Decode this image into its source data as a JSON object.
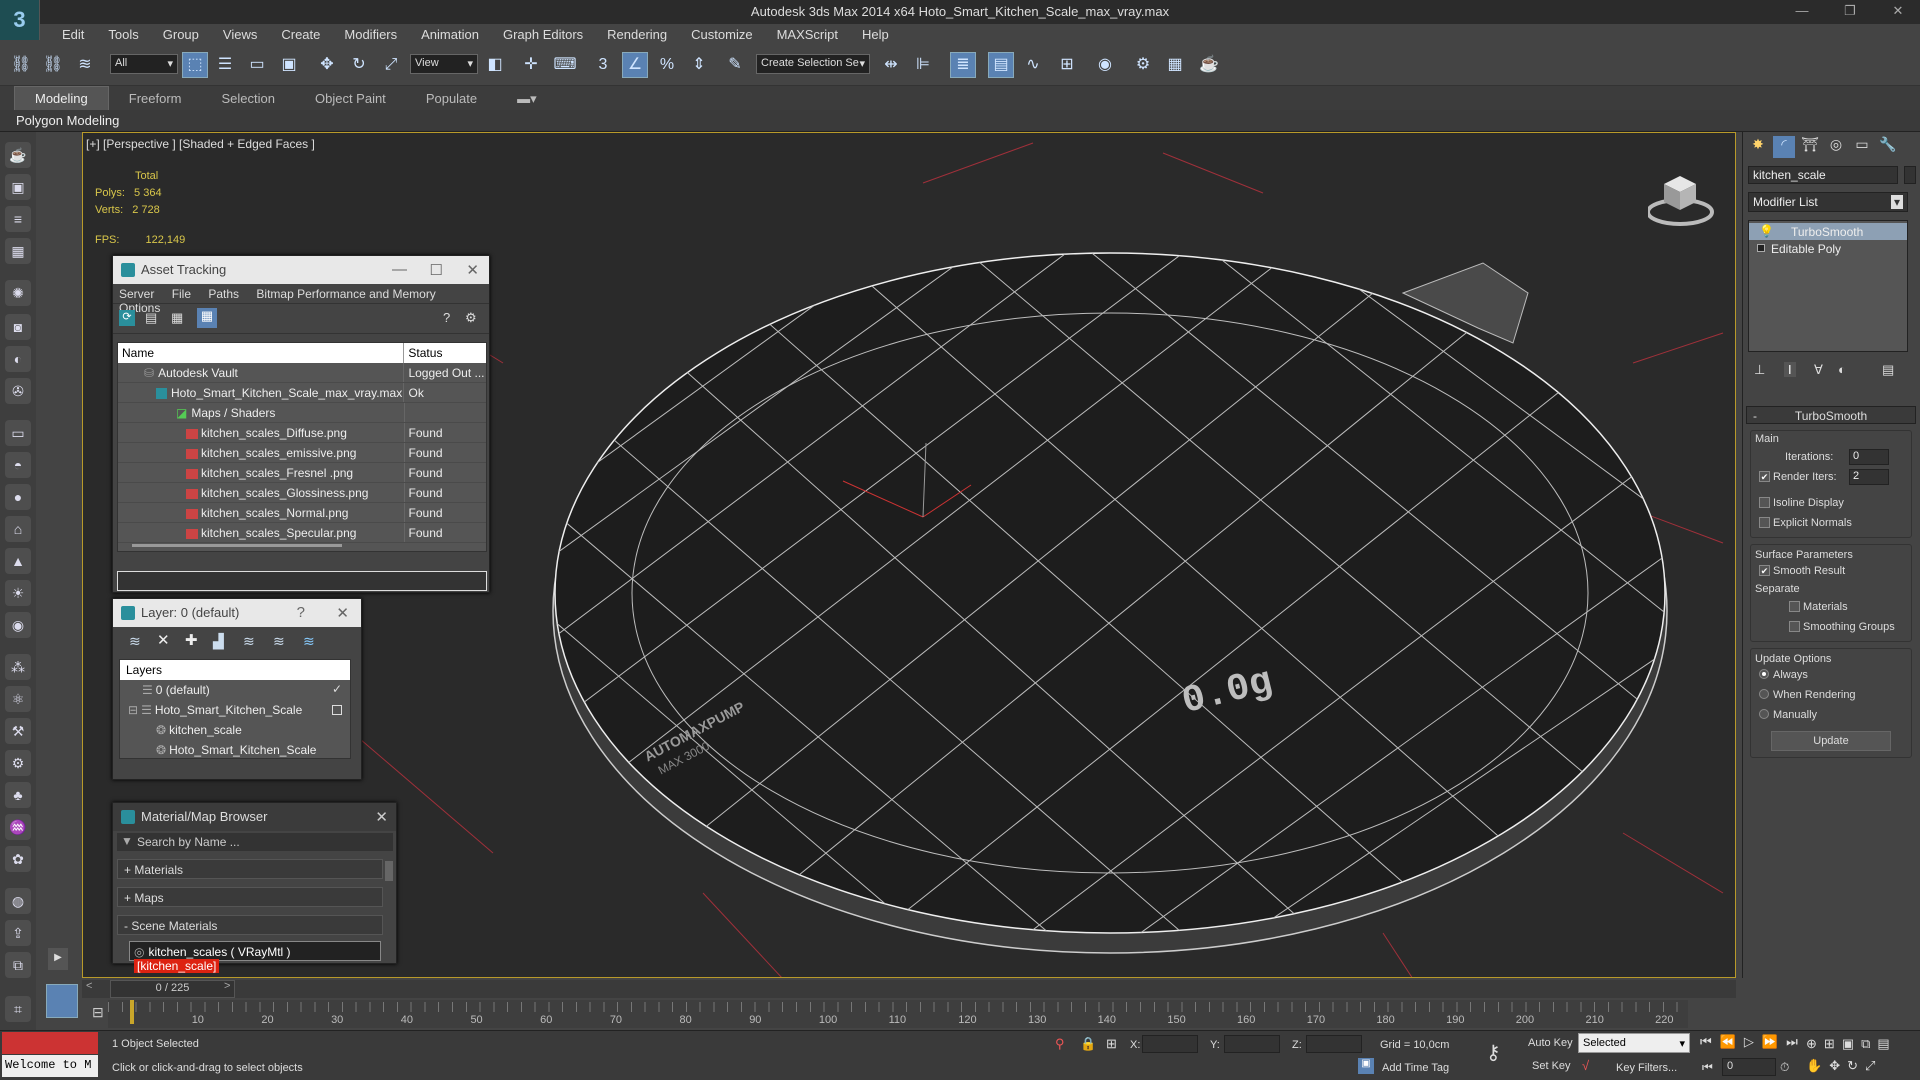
{
  "window": {
    "app": "Autodesk 3ds Max  2014 x64",
    "file": "Hoto_Smart_Kitchen_Scale_max_vray.max",
    "logo": "3"
  },
  "menu": [
    "Edit",
    "Tools",
    "Group",
    "Views",
    "Create",
    "Modifiers",
    "Animation",
    "Graph Editors",
    "Rendering",
    "Customize",
    "MAXScript",
    "Help"
  ],
  "toolbar": {
    "selection_filter": "All",
    "ref_coord": "View",
    "named_selection": "Create Selection Se"
  },
  "ribbon": {
    "tabs": [
      "Modeling",
      "Freeform",
      "Selection",
      "Object Paint",
      "Populate"
    ],
    "active_tab": "Modeling",
    "subpanel": "Polygon Modeling"
  },
  "viewport": {
    "label": "[+] [Perspective ] [Shaded + Edged Faces ]",
    "stats_header": "Total",
    "polys_label": "Polys:",
    "polys_value": "5 364",
    "verts_label": "Verts:",
    "verts_value": "2 728",
    "fps_label": "FPS:",
    "fps_value": "122,149",
    "display_digits": "0.0g",
    "model_text_1": "AUTOMAXPUMP",
    "model_text_2": "MAX 3000"
  },
  "asset_tracking": {
    "title": "Asset Tracking",
    "menu": [
      "Server",
      "File",
      "Paths",
      "Bitmap Performance and Memory",
      "Options"
    ],
    "columns": [
      "Name",
      "Status"
    ],
    "rows": [
      {
        "name": "Autodesk Vault",
        "status": "Logged Out ..."
      },
      {
        "name": "Hoto_Smart_Kitchen_Scale_max_vray.max",
        "status": "Ok"
      },
      {
        "name": "Maps / Shaders",
        "status": ""
      },
      {
        "name": "kitchen_scales_Diffuse.png",
        "status": "Found"
      },
      {
        "name": "kitchen_scales_emissive.png",
        "status": "Found"
      },
      {
        "name": "kitchen_scales_Fresnel .png",
        "status": "Found"
      },
      {
        "name": "kitchen_scales_Glossiness.png",
        "status": "Found"
      },
      {
        "name": "kitchen_scales_Normal.png",
        "status": "Found"
      },
      {
        "name": "kitchen_scales_Specular.png",
        "status": "Found"
      }
    ]
  },
  "layer": {
    "title": "Layer: 0 (default)",
    "help": "?",
    "header": "Layers",
    "items": [
      "0 (default)",
      "Hoto_Smart_Kitchen_Scale",
      "kitchen_scale",
      "Hoto_Smart_Kitchen_Scale"
    ]
  },
  "material_browser": {
    "title": "Material/Map Browser",
    "search_placeholder": "Search by Name ...",
    "sections": [
      "+ Materials",
      "+ Maps",
      "- Scene Materials"
    ],
    "item_name": "kitchen_scales  ( VRayMtl ) ",
    "item_tag": "[kitchen_scale]"
  },
  "command_panel": {
    "object_name": "kitchen_scale",
    "modifier_list": "Modifier List",
    "stack": [
      "TurboSmooth",
      "Editable Poly"
    ],
    "rollout_title": "TurboSmooth",
    "main_group": "Main",
    "iterations_label": "Iterations:",
    "iterations_value": "0",
    "render_iters_label": "Render Iters:",
    "render_iters_value": "2",
    "isoline": "Isoline Display",
    "explicit_normals": "Explicit Normals",
    "surface_group": "Surface Parameters",
    "smooth_result": "Smooth Result",
    "separate": "Separate",
    "materials": "Materials",
    "smoothing_groups": "Smoothing Groups",
    "update_group": "Update Options",
    "always": "Always",
    "when_rendering": "When Rendering",
    "manually": "Manually",
    "update_button": "Update"
  },
  "timeline": {
    "counter": "0 / 225",
    "ticks": [
      "10",
      "20",
      "30",
      "40",
      "50",
      "60",
      "70",
      "80",
      "90",
      "100",
      "110",
      "120",
      "130",
      "140",
      "150",
      "160",
      "170",
      "180",
      "190",
      "200",
      "210",
      "220"
    ]
  },
  "status": {
    "welcome": "Welcome to M",
    "selected": "1 Object Selected",
    "prompt": "Click or click-and-drag to select objects",
    "x_label": "X:",
    "y_label": "Y:",
    "z_label": "Z:",
    "grid": "Grid = 10,0cm",
    "auto_key": "Auto Key",
    "set_key": "Set Key",
    "key_mode": "Selected",
    "key_filters": "Key Filters...",
    "add_time_tag": "Add Time Tag",
    "frame_value": "0"
  },
  "colors": {
    "accent_blue": "#5a82b3",
    "viewport_border": "#b89a2a",
    "stats_yellow": "#d8c64a",
    "tag_red": "#dd2211"
  }
}
